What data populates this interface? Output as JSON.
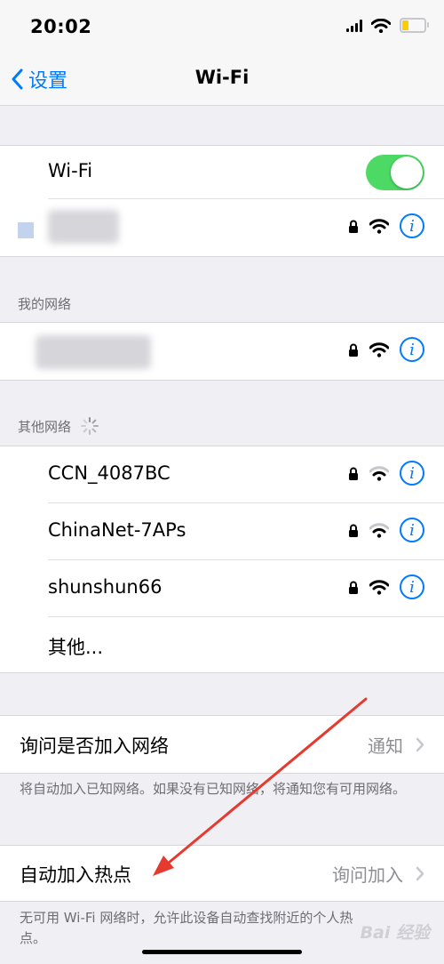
{
  "status_bar": {
    "time": "20:02"
  },
  "nav": {
    "back_label": "设置",
    "title": "Wi-Fi"
  },
  "wifi_toggle": {
    "label": "Wi-Fi",
    "enabled": true
  },
  "sections": {
    "my_networks": "我的网络",
    "other_networks": "其他网络"
  },
  "other_networks": [
    {
      "name": "CCN_4087BC",
      "locked": true
    },
    {
      "name": "ChinaNet-7APs",
      "locked": true
    },
    {
      "name": "shunshun66",
      "locked": true
    }
  ],
  "other_label": "其他...",
  "ask_to_join": {
    "label": "询问是否加入网络",
    "value": "通知",
    "note": "将自动加入已知网络。如果没有已知网络，将通知您有可用网络。"
  },
  "auto_join_hotspot": {
    "label": "自动加入热点",
    "value": "询问加入",
    "note": "无可用 Wi-Fi 网络时，允许此设备自动查找附近的个人热点。"
  },
  "watermark": "Bai 经验",
  "colors": {
    "accent": "#007aff",
    "toggle_on": "#4cd964",
    "annotation_arrow": "#e53a2f"
  }
}
